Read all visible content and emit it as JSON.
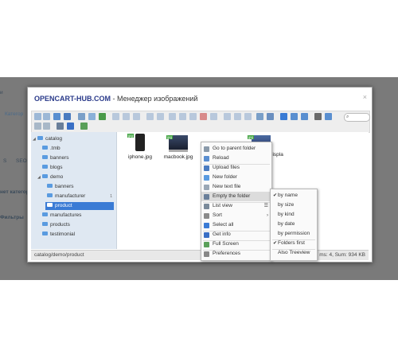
{
  "background": {
    "left_texts": [
      "и",
      "Категор",
      "S",
      "SEO",
      "нет категори",
      "Фильтры"
    ]
  },
  "dialog": {
    "brand": "OPENCART-HUB.COM",
    "separator": " - ",
    "subtitle": "Менеджер изображений",
    "close": "×"
  },
  "toolbar": {
    "search_placeholder": "⌕"
  },
  "tree": [
    {
      "label": "catalog",
      "expanded": true
    },
    {
      "label": ".tmb"
    },
    {
      "label": "banners"
    },
    {
      "label": "blogs"
    },
    {
      "label": "demo",
      "expanded": true
    },
    {
      "label": "banners"
    },
    {
      "label": "manufacturer",
      "count": "1"
    },
    {
      "label": "product",
      "selected": true
    },
    {
      "label": "manufactures"
    },
    {
      "label": "products"
    },
    {
      "label": "testimonial"
    }
  ],
  "files": [
    {
      "name": "iphone.jpg",
      "badge": "jpg"
    },
    {
      "name": "macbook.jpg",
      "badge": "jpg"
    },
    {
      "name": "",
      "badge": "jpg"
    },
    {
      "name": "derboltdispla y.jpg",
      "badge": "jpg"
    }
  ],
  "status": {
    "path": "catalog/demo/product",
    "summary": "ms: 4, Sum: 934 KB"
  },
  "context_menu": {
    "items": [
      {
        "label": "Go to parent folder",
        "color": "#8a9aaa"
      },
      {
        "label": "Reload",
        "color": "#5a8ed0"
      },
      {
        "label": "Upload files",
        "color": "#4a7bc0"
      },
      {
        "label": "New folder",
        "color": "#5a9be0"
      },
      {
        "label": "New text file",
        "color": "#9aa7b5"
      },
      {
        "label": "Empty the folder",
        "color": "#6a7f9a",
        "highlight": true
      },
      {
        "label": "List view",
        "color": "#7a8a9a",
        "arrow": "☰"
      },
      {
        "label": "Sort",
        "color": "#8a8a8a",
        "arrow": "›"
      },
      {
        "label": "Select all",
        "color": "#3a7bd5"
      },
      {
        "label": "Get info",
        "color": "#3a6fc5"
      },
      {
        "label": "Full Screen",
        "color": "#5aa05a"
      },
      {
        "label": "Preferences",
        "color": "#888888"
      }
    ]
  },
  "sort_menu": {
    "items": [
      {
        "label": "by name",
        "checked": true
      },
      {
        "label": "by size"
      },
      {
        "label": "by kind"
      },
      {
        "label": "by date"
      },
      {
        "label": "by permission"
      },
      {
        "label": "Folders first",
        "checked": true
      },
      {
        "label": "Also Treeview"
      }
    ]
  }
}
